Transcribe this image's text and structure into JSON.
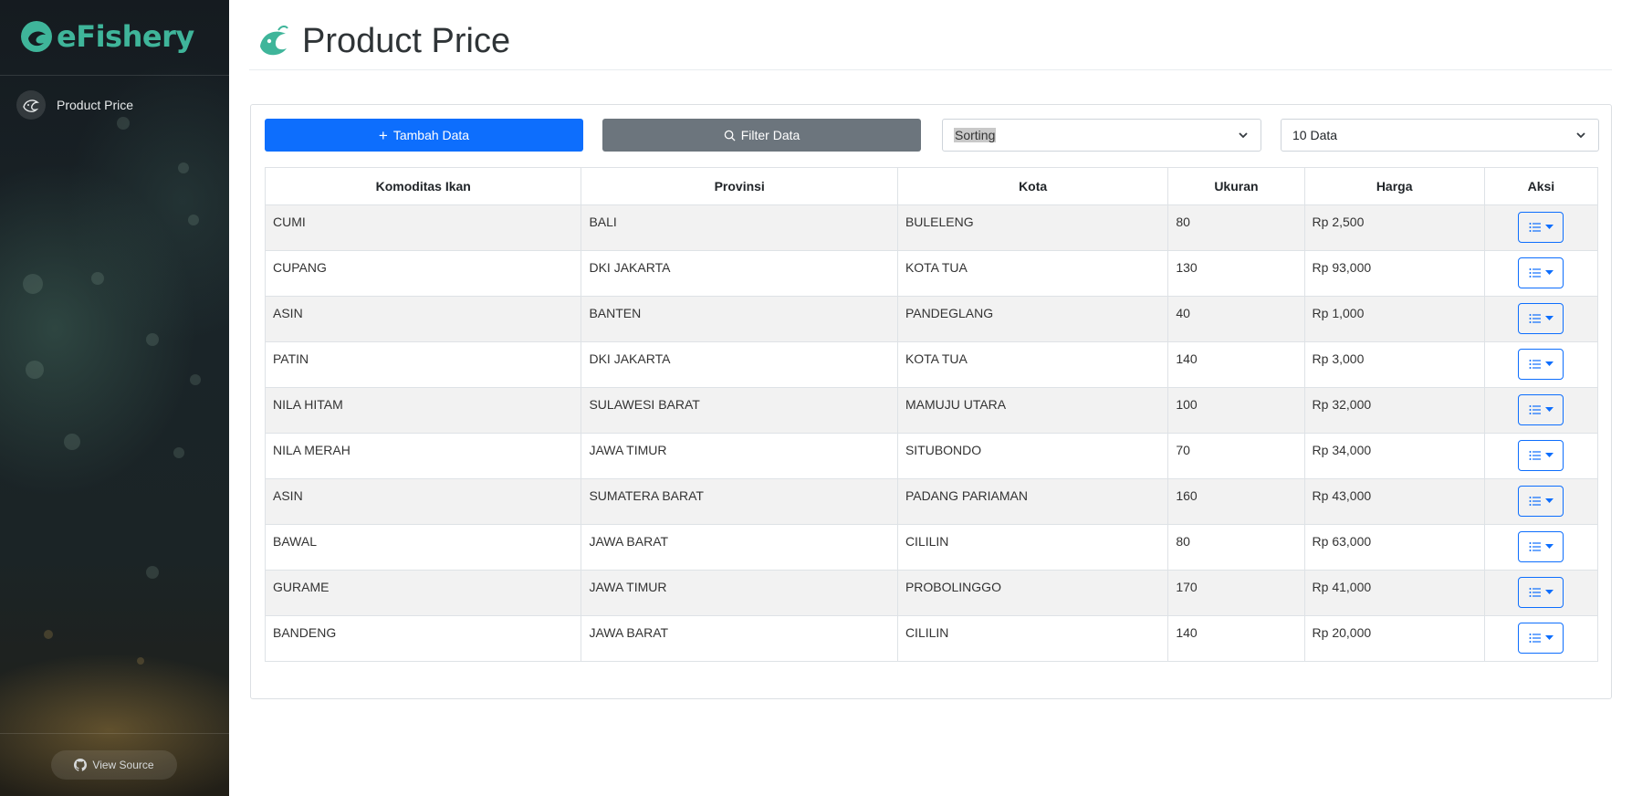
{
  "app": {
    "logo_text": "eFishery",
    "brand_color": "#3fb59a"
  },
  "sidebar": {
    "items": [
      {
        "label": "Product Price",
        "icon": "fish-icon"
      }
    ],
    "view_source_label": "View Source"
  },
  "header": {
    "title": "Product Price",
    "icon": "fish-icon"
  },
  "toolbar": {
    "add_label": "Tambah Data",
    "filter_label": "Filter Data",
    "sort_value": "Sorting",
    "size_value": "10 Data",
    "add_color": "#0d6efd",
    "filter_color": "#6c757d"
  },
  "table": {
    "columns": [
      "Komoditas Ikan",
      "Provinsi",
      "Kota",
      "Ukuran",
      "Harga",
      "Aksi"
    ],
    "rows": [
      {
        "komoditas": "CUMI",
        "provinsi": "BALI",
        "kota": "BULELENG",
        "ukuran": "80",
        "harga": "Rp 2,500"
      },
      {
        "komoditas": "CUPANG",
        "provinsi": "DKI JAKARTA",
        "kota": "KOTA TUA",
        "ukuran": "130",
        "harga": "Rp 93,000"
      },
      {
        "komoditas": "ASIN",
        "provinsi": "BANTEN",
        "kota": "PANDEGLANG",
        "ukuran": "40",
        "harga": "Rp 1,000"
      },
      {
        "komoditas": "PATIN",
        "provinsi": "DKI JAKARTA",
        "kota": "KOTA TUA",
        "ukuran": "140",
        "harga": "Rp 3,000"
      },
      {
        "komoditas": "NILA HITAM",
        "provinsi": "SULAWESI BARAT",
        "kota": "MAMUJU UTARA",
        "ukuran": "100",
        "harga": "Rp 32,000"
      },
      {
        "komoditas": "NILA MERAH",
        "provinsi": "JAWA TIMUR",
        "kota": "SITUBONDO",
        "ukuran": "70",
        "harga": "Rp 34,000"
      },
      {
        "komoditas": "ASIN",
        "provinsi": "SUMATERA BARAT",
        "kota": "PADANG PARIAMAN",
        "ukuran": "160",
        "harga": "Rp 43,000"
      },
      {
        "komoditas": "BAWAL",
        "provinsi": "JAWA BARAT",
        "kota": "CILILIN",
        "ukuran": "80",
        "harga": "Rp 63,000"
      },
      {
        "komoditas": "GURAME",
        "provinsi": "JAWA TIMUR",
        "kota": "PROBOLINGGO",
        "ukuran": "170",
        "harga": "Rp 41,000"
      },
      {
        "komoditas": "BANDENG",
        "provinsi": "JAWA BARAT",
        "kota": "CILILIN",
        "ukuran": "140",
        "harga": "Rp 20,000"
      }
    ]
  }
}
